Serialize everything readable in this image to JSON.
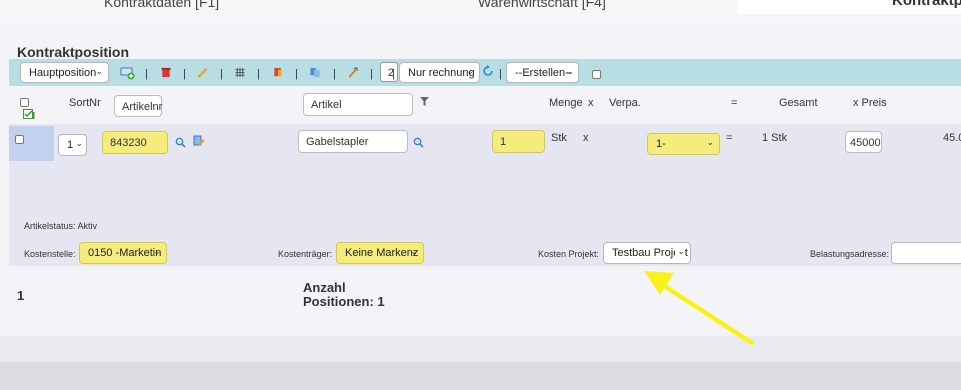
{
  "tabs": [
    {
      "label": "Kontraktdaten [F1]",
      "active": false
    },
    {
      "label": "Warenwirtschaft [F4]",
      "active": false
    },
    {
      "label": "Kontraktpo",
      "active": true
    }
  ],
  "section_title": "Kontraktposition",
  "toolbar": {
    "position_type": "Hauptposition",
    "qty_value": "2",
    "filter_select": "Nur rechnung",
    "create_select": "--Erstellen--",
    "colors": {
      "bg": "#b8dde2"
    }
  },
  "header": {
    "sortnr": "SortNr",
    "artikelnr": "Artikelnr",
    "artikel": "Artikel",
    "menge": "Menge",
    "x1": "x",
    "verpa": "Verpa.",
    "eq": "=",
    "gesamt": "Gesamt",
    "xpreis": "x Preis"
  },
  "row": {
    "sort_value": "1",
    "artikelnr": "843230",
    "artikel": "Gabelstapler",
    "menge": "1",
    "unit": "Stk",
    "x": "x",
    "verpa": "1-",
    "eq": "=",
    "gesamt": "1 Stk",
    "preis": "45000",
    "total_partial": "45.0"
  },
  "details": {
    "artikelstatus": "Artikelstatus: Aktiv",
    "kostenstelle_label": "Kostenstelle:",
    "kostenstelle_value": "0150 -Marketin",
    "kostentraeger_label": "Kostenträger:",
    "kostentraeger_value": "Keine Markenz",
    "kosten_projekt_label": "Kosten Projekt:",
    "kosten_projekt_value": "Testbau Projekt",
    "belastungsadresse_label": "Belastungsadresse:"
  },
  "footer": {
    "count": "1",
    "anzahl_line1": "Anzahl",
    "anzahl_line2": "Positionen: 1"
  },
  "annotation": {
    "color": "#f7f219"
  }
}
